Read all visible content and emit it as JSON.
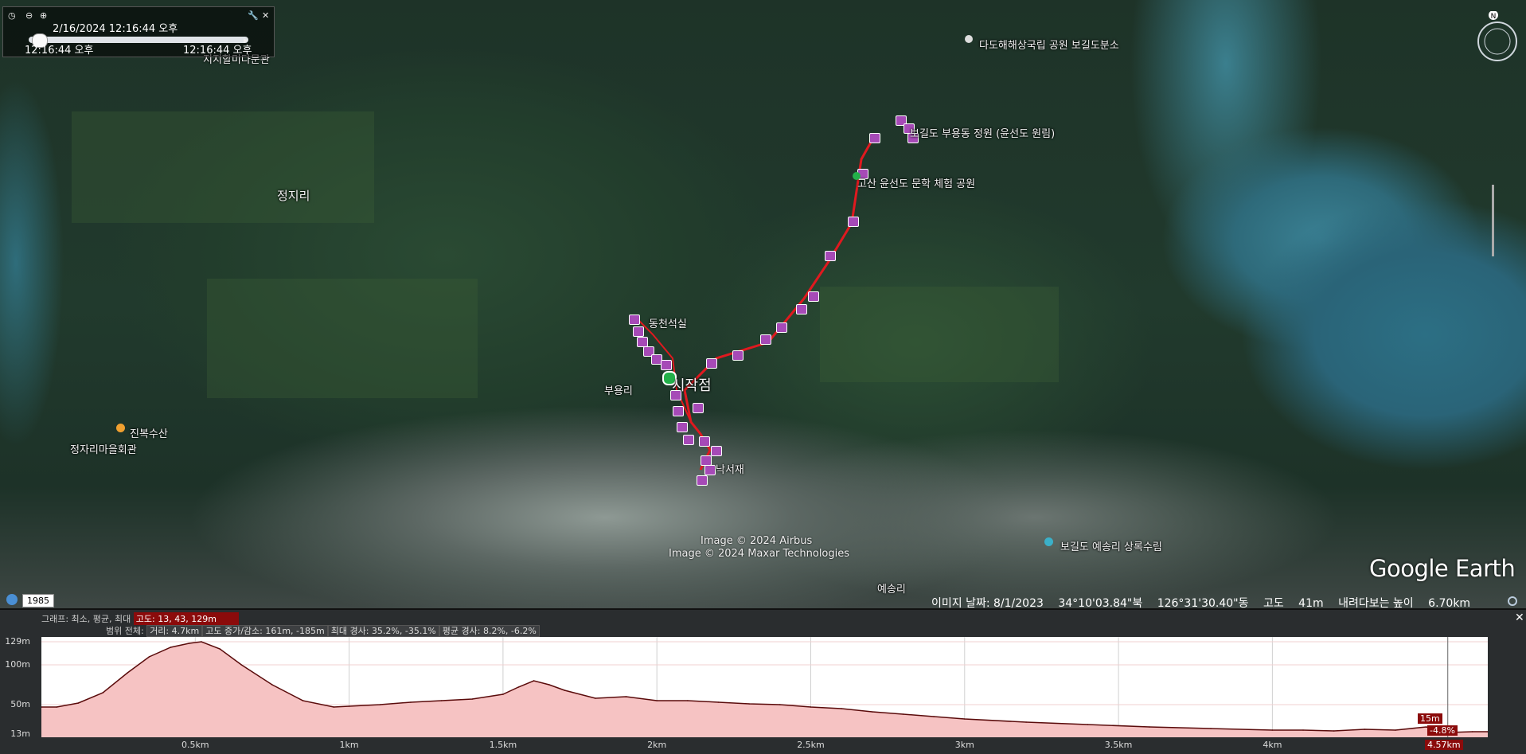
{
  "app": {
    "name": "Google Earth"
  },
  "time_slider": {
    "date_time": "2/16/2024  12:16:44 오후",
    "start_time": "12:16:44 오후",
    "end_time": "12:16:44 오후",
    "progress": 0.0
  },
  "map_labels": {
    "jeongjiri": "정지리",
    "park_office": "다도해해상국립 공원 보길도분소",
    "buyongdong": "보길도 부용동 정원 (윤선도 원림)",
    "literature_park": "고산 윤선도 문학 체험 공원",
    "dongcheonseoksil": "동천석실",
    "buyongri": "부용리",
    "start_point": "시작점",
    "nakseojae": "낙서재",
    "jinbok": "진복수산",
    "village_hall": "정자리마을회관",
    "yesongri": "예송리",
    "yesongri_forest": "보길도 예송리 상록수림",
    "top_left_place": "지지할미다문관"
  },
  "imagery_credits": [
    "Image © 2024 Airbus",
    "Image © 2024 Maxar Technologies"
  ],
  "imagery_year": "1985",
  "status_bar": {
    "image_date": "이미지 날짜: 8/1/2023",
    "lat": "34°10'03.84\"북",
    "lon": "126°31'30.40\"동",
    "elevation_label": "고도",
    "elevation": "41m",
    "eye_alt_label": "내려다보는 높이",
    "eye_alt": "6.70km"
  },
  "elevation_profile": {
    "graph_label": "그래프: 최소, 평균, 최대",
    "graph_values": "고도: 13, 43, 129m",
    "range_label": "범위 전체:",
    "distance": "거리: 4.7km",
    "gain_loss": "고도 증가/감소: 161m, -185m",
    "max_slope": "최대 경사: 35.2%, -35.1%",
    "avg_slope": "평균 경사: 8.2%, -6.2%",
    "cursor_elev": "15m",
    "cursor_slope": "-4.8%",
    "cursor_dist": "4.57km",
    "accent_color": "#8b0b0b",
    "fill_color": "#f6c3c3",
    "line_color": "#5a0b0b"
  },
  "chart_data": {
    "type": "area",
    "xlabel": "",
    "ylabel": "",
    "ylim": [
      13,
      129
    ],
    "xlim": [
      0,
      4.7
    ],
    "y_ticks": [
      "129m",
      "100m",
      "50m",
      "13m"
    ],
    "x_ticks": [
      "0.5km",
      "1km",
      "1.5km",
      "2km",
      "2.5km",
      "3km",
      "3.5km",
      "4km"
    ],
    "x": [
      0,
      0.05,
      0.12,
      0.2,
      0.28,
      0.35,
      0.42,
      0.48,
      0.52,
      0.58,
      0.65,
      0.75,
      0.85,
      0.95,
      1.0,
      1.1,
      1.2,
      1.3,
      1.4,
      1.5,
      1.55,
      1.6,
      1.65,
      1.7,
      1.8,
      1.9,
      2.0,
      2.1,
      2.2,
      2.3,
      2.4,
      2.5,
      2.6,
      2.7,
      2.8,
      2.9,
      3.0,
      3.2,
      3.4,
      3.6,
      3.8,
      4.0,
      4.1,
      4.2,
      4.3,
      4.4,
      4.5,
      4.57,
      4.65,
      4.7
    ],
    "y": [
      47,
      47,
      52,
      65,
      90,
      110,
      122,
      127,
      129,
      120,
      100,
      75,
      55,
      47,
      48,
      50,
      53,
      55,
      57,
      63,
      72,
      80,
      75,
      68,
      58,
      60,
      55,
      55,
      53,
      51,
      50,
      47,
      45,
      41,
      38,
      35,
      32,
      28,
      25,
      22,
      20,
      18,
      18,
      17,
      19,
      18,
      22,
      15,
      16,
      16
    ]
  }
}
